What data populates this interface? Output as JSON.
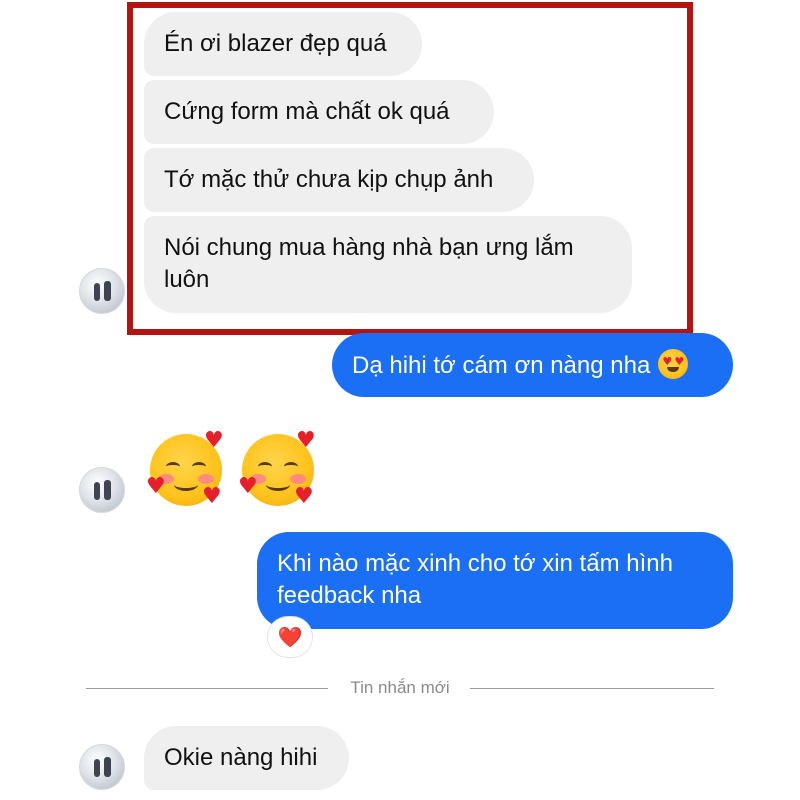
{
  "conversation": {
    "incoming_group_1": [
      "Én ơi blazer đẹp quá",
      "Cứng form mà chất ok quá",
      "Tớ mặc thử chưa kịp chụp ảnh"
    ],
    "incoming_group_1_last": {
      "line1": "Nói chung mua hàng nhà bạn ưng lắm",
      "line2": "luôn"
    },
    "outgoing_1": {
      "text": "Dạ hihi tớ cám ơn nàng nha",
      "emoji": "smiling-face-with-heart-eyes"
    },
    "incoming_emoji_message": {
      "emoji": "smiling-face-with-hearts",
      "count": 2
    },
    "outgoing_2": {
      "line1": "Khi nào mặc xinh cho tớ xin tấm hình",
      "line2": "feedback nha",
      "reaction": "❤️"
    },
    "new_messages_divider": "Tin nhắn mới",
    "incoming_last": "Okie nàng hihi"
  },
  "colors": {
    "highlight_border": "#b3140f",
    "incoming_bubble": "#efefef",
    "outgoing_bubble": "#1b6ff5",
    "reaction_heart": "#e5202b"
  },
  "icons": {
    "avatar": "contact-avatar-photo",
    "reaction": "heart-icon"
  }
}
